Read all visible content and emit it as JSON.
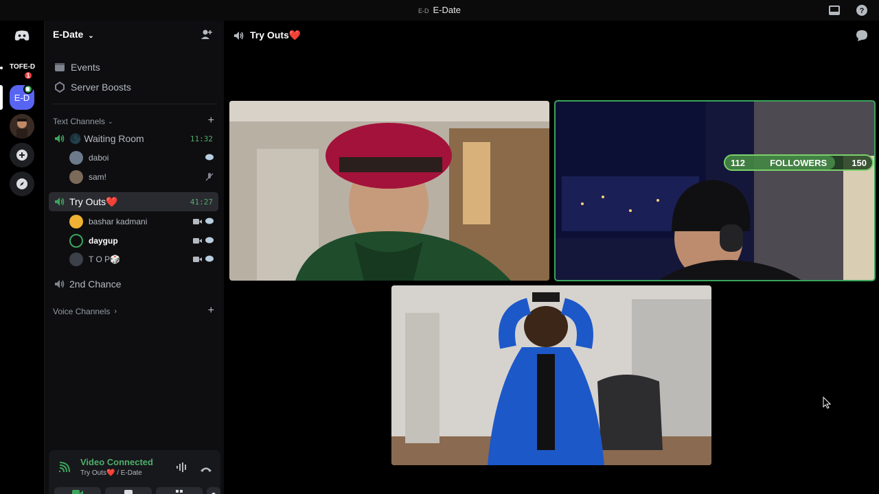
{
  "app": {
    "window_title": "E-Date",
    "window_mini_label": "E-D"
  },
  "servers": {
    "tofe_label": "TOFE-D",
    "tofe_badge": "1",
    "active_label": "E-D"
  },
  "sidebar": {
    "guild_name": "E-Date",
    "events_label": "Events",
    "boosts_label": "Server Boosts",
    "text_category": "Text Channels",
    "voice_category": "Voice Channels",
    "channels": [
      {
        "name": "🌑 Waiting Room",
        "time": "11:32",
        "members": [
          {
            "name": "daboi"
          },
          {
            "name": "sam!"
          }
        ]
      },
      {
        "name": "Try Outs❤️",
        "time": "41:27",
        "members": [
          {
            "name": "bashar kadmani"
          },
          {
            "name": "daygup"
          },
          {
            "name": "T O P🎲"
          }
        ]
      },
      {
        "name": "2nd Chance"
      }
    ]
  },
  "voice_panel": {
    "status": "Video Connected",
    "location": "Try Outs❤️ / E-Date"
  },
  "main": {
    "channel_title": "Try Outs❤️",
    "stream_overlay": {
      "followers_current": "112",
      "followers_label": "FOLLOWERS",
      "followers_goal": "150",
      "progress_fraction": 0.747
    }
  },
  "colors": {
    "accent_green": "#3ba55c",
    "brand_blurple": "#5865f2",
    "badge_red": "#f23f43"
  }
}
